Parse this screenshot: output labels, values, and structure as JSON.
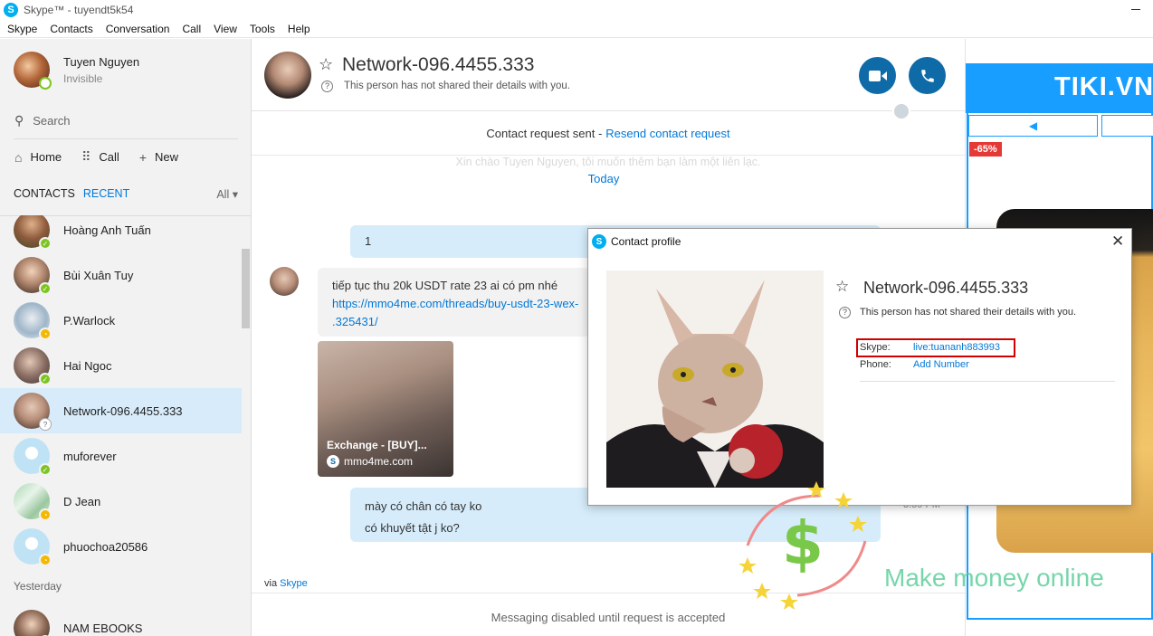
{
  "window": {
    "title": "Skype™ - tuyendt5k54"
  },
  "menu": [
    "Skype",
    "Contacts",
    "Conversation",
    "Call",
    "View",
    "Tools",
    "Help"
  ],
  "profile": {
    "name": "Tuyen Nguyen",
    "status": "Invisible"
  },
  "search": {
    "label": "Search"
  },
  "nav": {
    "home": "Home",
    "call": "Call",
    "new": "New"
  },
  "tabs": {
    "contacts": "CONTACTS",
    "recent": "RECENT",
    "filter": "All"
  },
  "contacts": [
    {
      "name": "Hoàng Anh Tuấn",
      "status": "online"
    },
    {
      "name": "Bùi Xuân Tuy",
      "status": "online"
    },
    {
      "name": "P.Warlock",
      "status": "away"
    },
    {
      "name": "Hai Ngoc",
      "status": "online"
    },
    {
      "name": "Network-096.4455.333",
      "status": "unknown"
    },
    {
      "name": "muforever",
      "status": "online"
    },
    {
      "name": "D Jean",
      "status": "away"
    },
    {
      "name": "phuochoa20586",
      "status": "away"
    }
  ],
  "section_yesterday": "Yesterday",
  "contacts_yesterday": [
    {
      "name": "NAM EBOOKS",
      "status": "online"
    }
  ],
  "chat": {
    "contact_name": "Network-096.4455.333",
    "privacy_note": "This person has not shared their details with you.",
    "request_sent": "Contact request sent -",
    "resend": "Resend contact request",
    "faint_greeting": "Xin chào Tuyen Nguyen, tôi muốn thêm bạn làm một liên lạc.",
    "today": "Today",
    "messages": {
      "out1": "1",
      "in_text": "tiếp tục thu 20k USDT rate 23 ai có pm nhé",
      "in_link_1": "https://mmo4me.com/threads/buy-usdt-23-wex-",
      "in_link_2": ".325431/",
      "card_title": "Exchange - [BUY]...",
      "card_site": "mmo4me.com",
      "out2_line1": "mày có chân có tay ko",
      "out2_line2": "có khuyết tật j ko?",
      "time": "3:59 PM"
    },
    "via_prefix": "via",
    "via_link": "Skype",
    "disabled_note": "Messaging disabled until request is accepted"
  },
  "ad": {
    "brand": "TIKI.VN",
    "prev_arrow": "◀",
    "discount": "-65%"
  },
  "popup": {
    "title": "Contact profile",
    "close": "✕",
    "name": "Network-096.4455.333",
    "note": "This person has not shared their details with you.",
    "skype_label": "Skype:",
    "skype_value": "live:tuananh883993",
    "phone_label": "Phone:",
    "phone_value": "Add Number"
  },
  "watermark": {
    "text": "Make money online"
  },
  "colors": {
    "accent": "#0078d7",
    "call_button": "#0f6aa8",
    "online": "#7cc520",
    "away": "#f5b800",
    "highlight": "#d20000",
    "ad_blue": "#189eff"
  }
}
